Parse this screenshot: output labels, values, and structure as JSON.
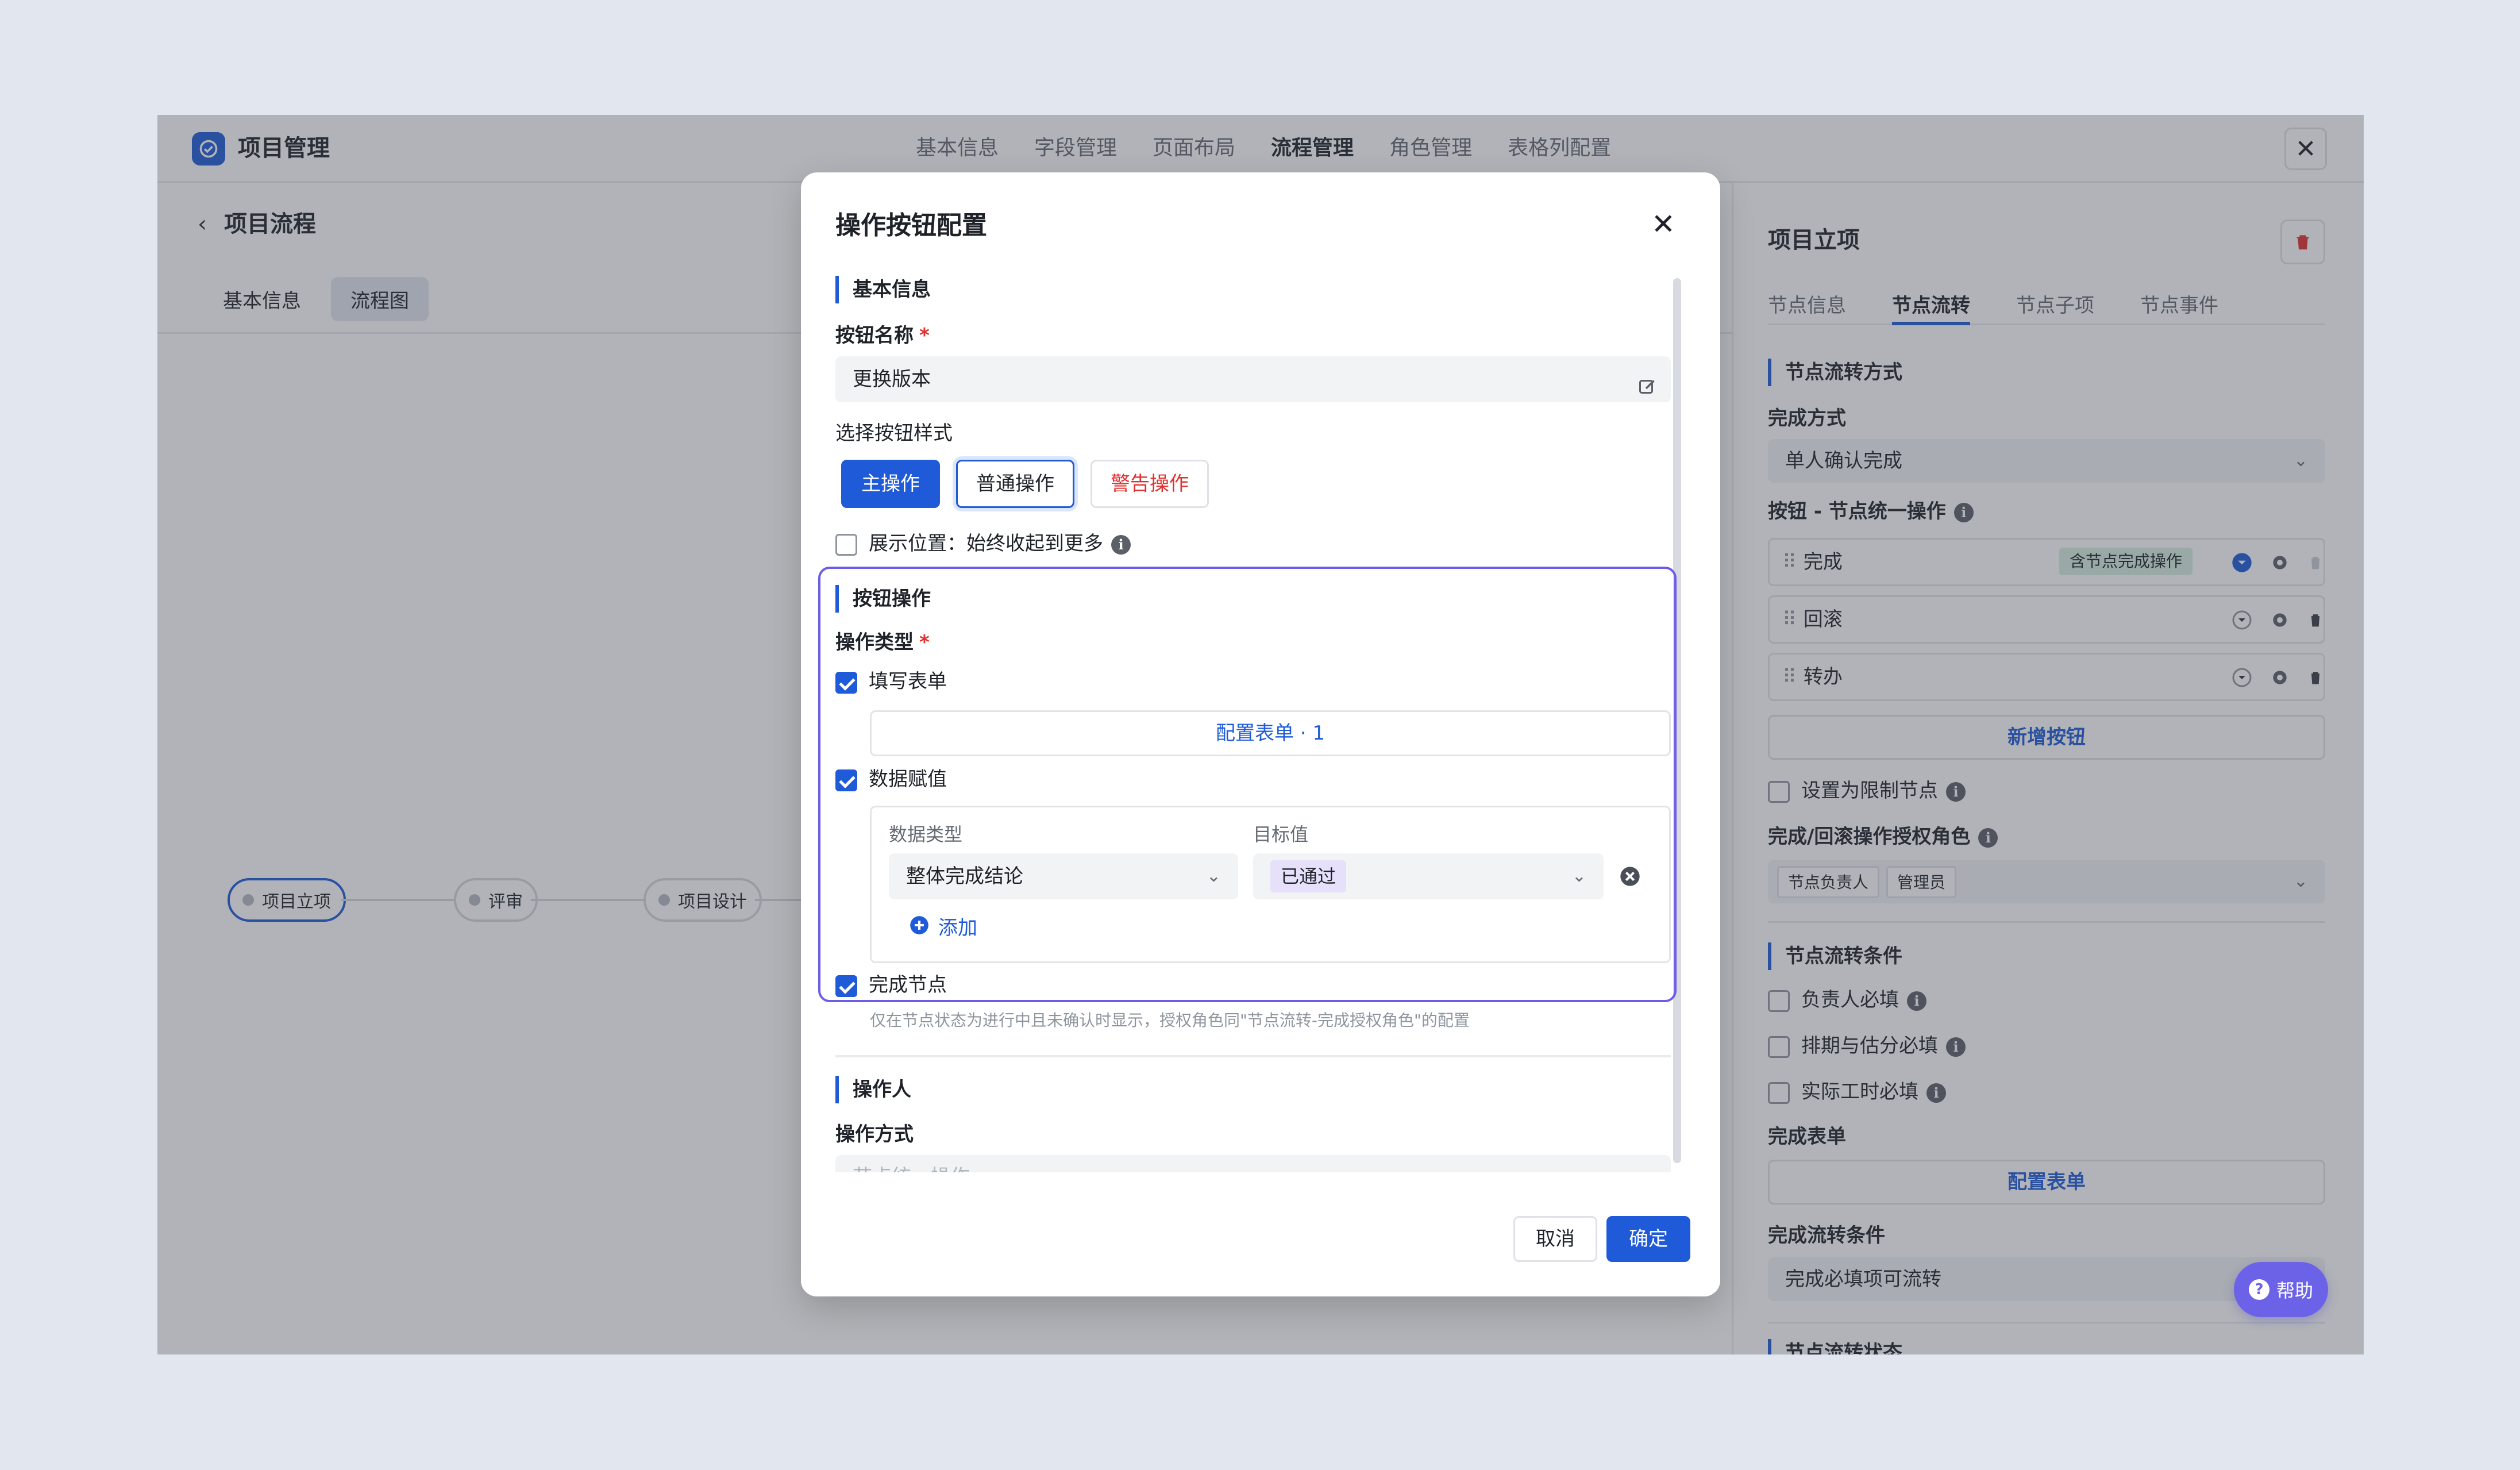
{
  "app": {
    "title": "项目管理"
  },
  "top_tabs": [
    "基本信息",
    "字段管理",
    "页面布局",
    "流程管理",
    "角色管理",
    "表格列配置"
  ],
  "left": {
    "breadcrumb": "项目流程",
    "subtabs": [
      "基本信息",
      "流程图"
    ],
    "nodes": [
      "项目立项",
      "评审",
      "项目设计"
    ]
  },
  "right": {
    "title": "项目立项",
    "tabs": [
      "节点信息",
      "节点流转",
      "节点子项",
      "节点事件"
    ],
    "flow_section": "节点流转方式",
    "complete_mode_label": "完成方式",
    "complete_mode_value": "单人确认完成",
    "buttons_label": "按钮 - 节点统一操作",
    "buttons": [
      {
        "label": "完成",
        "tag": "含节点完成操作"
      },
      {
        "label": "回滚"
      },
      {
        "label": "转办"
      }
    ],
    "add_button": "新增按钮",
    "limit_node": "设置为限制节点",
    "auth_roles_label": "完成/回滚操作授权角色",
    "auth_roles": [
      "节点负责人",
      "管理员"
    ],
    "cond_section": "节点流转条件",
    "conditions": [
      "负责人必填",
      "排期与估分必填",
      "实际工时必填"
    ],
    "complete_form_label": "完成表单",
    "config_form": "配置表单",
    "complete_cond_label": "完成流转条件",
    "complete_cond_value": "完成必填项可流转",
    "status_section": "节点流转状态",
    "help": "帮助"
  },
  "modal": {
    "title": "操作按钮配置",
    "basic_section": "基本信息",
    "name_label": "按钮名称",
    "name_value": "更换版本",
    "style_label": "选择按钮样式",
    "styles": [
      "主操作",
      "普通操作",
      "警告操作"
    ],
    "display_position": "展示位置：始终收起到更多",
    "action_section": "按钮操作",
    "op_type_label": "操作类型",
    "fill_form": "填写表单",
    "config_form_btn": "配置表单 · 1",
    "data_assign": "数据赋值",
    "data_type_label": "数据类型",
    "target_label": "目标值",
    "data_type_value": "整体完成结论",
    "target_value": "已通过",
    "add": "添加",
    "complete_node": "完成节点",
    "complete_hint": "仅在节点状态为进行中且未确认时显示，授权角色同\"节点流转-完成授权角色\"的配置",
    "operator_section": "操作人",
    "op_mode_label": "操作方式",
    "op_mode_placeholder": "节点统一操作",
    "cancel": "取消",
    "ok": "确定"
  },
  "colors": {
    "primary": "#1f5bd8",
    "danger": "#e0302f",
    "highlight": "#6c5ce7",
    "help": "#6c62e8"
  }
}
